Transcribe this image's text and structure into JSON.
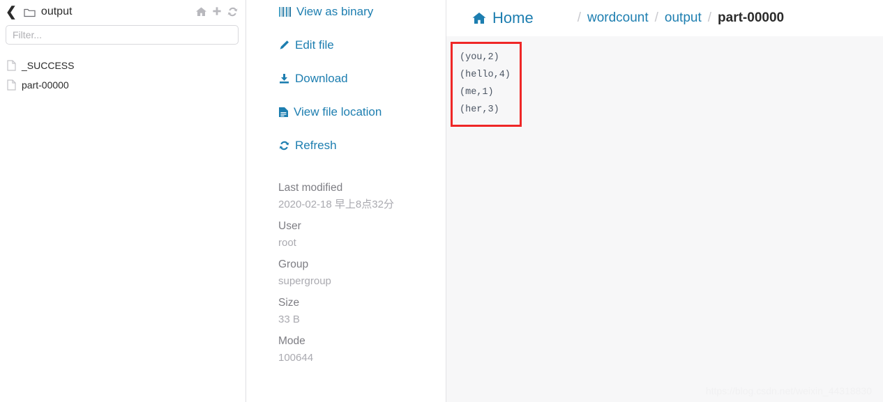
{
  "sidebar": {
    "back_icon": "chevron-left-icon",
    "folder_icon": "folder-icon",
    "title": "output",
    "header_actions": [
      {
        "icon": "home-icon",
        "name": "home"
      },
      {
        "icon": "plus-icon",
        "name": "new"
      },
      {
        "icon": "refresh-icon",
        "name": "refresh"
      }
    ],
    "filter": {
      "placeholder": "Filter...",
      "value": ""
    },
    "files": [
      {
        "icon": "file-icon",
        "name": "_SUCCESS"
      },
      {
        "icon": "file-icon",
        "name": "part-00000"
      }
    ]
  },
  "actions": [
    {
      "icon": "barcode-icon",
      "label": "View as binary"
    },
    {
      "icon": "pencil-icon",
      "label": "Edit file"
    },
    {
      "icon": "download-icon",
      "label": "Download"
    },
    {
      "icon": "file-text-icon",
      "label": "View file location"
    },
    {
      "icon": "refresh-icon",
      "label": "Refresh"
    }
  ],
  "metadata": [
    {
      "label": "Last modified",
      "value": "2020-02-18 早上8点32分"
    },
    {
      "label": "User",
      "value": "root"
    },
    {
      "label": "Group",
      "value": "supergroup"
    },
    {
      "label": "Size",
      "value": "33 B"
    },
    {
      "label": "Mode",
      "value": "100644"
    }
  ],
  "breadcrumb": {
    "home_icon": "home-icon",
    "home_label": "Home",
    "separator": "/",
    "links": [
      "wordcount",
      "output"
    ],
    "current": "part-00000"
  },
  "file_content": {
    "text": "(you,2)\n(hello,4)\n(me,1)\n(her,3)",
    "highlight_color": "#ef2727"
  },
  "watermark": "https://blog.csdn.net/weixin_44318830",
  "colors": {
    "link": "#1d7eb0",
    "panel_bg": "#f7f7f8",
    "muted": "#aaaab0"
  }
}
